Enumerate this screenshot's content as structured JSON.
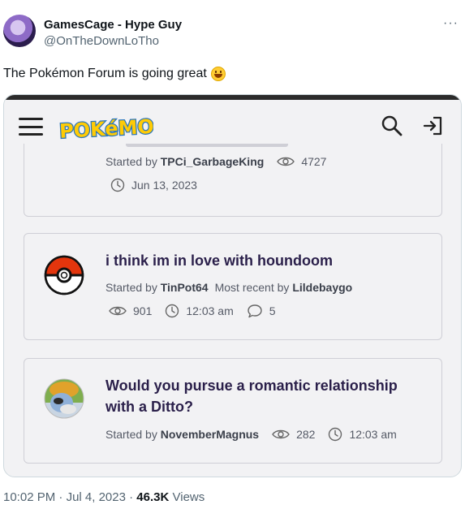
{
  "tweet": {
    "display_name": "GamesCage - Hype Guy",
    "handle": "@OnTheDownLoTho",
    "more_label": "···",
    "text": "The Pokémon Forum is going great",
    "time": "10:02 PM",
    "date": "Jul 4, 2023",
    "separator": "·",
    "views_count": "46.3K",
    "views_label": "Views"
  },
  "forum": {
    "logo_text": "POKéMON",
    "threads": [
      {
        "started_label": "Started by",
        "author": "TPCi_GarbageKing",
        "views": "4727",
        "date": "Jun 13, 2023"
      },
      {
        "title": "i think im in love with houndoom",
        "started_label": "Started by",
        "author": "TinPot64",
        "recent_label": "Most recent by",
        "recent_author": "Lildebaygo",
        "views": "901",
        "time": "12:03 am",
        "replies": "5"
      },
      {
        "title_line1": "Would you pursue a romantic relationship",
        "title_line2": "with a Ditto?",
        "started_label": "Started by",
        "author": "NovemberMagnus",
        "views": "282",
        "time": "12:03 am"
      }
    ]
  },
  "icons": {
    "menu": "hamburger-icon",
    "search": "search-icon",
    "signin": "sign-in-icon",
    "views": "eye-icon",
    "time": "clock-icon",
    "replies": "comment-icon",
    "avatar_pokeball": "pokeball-icon"
  },
  "colors": {
    "title": "#2a1f4a",
    "meta": "#555a66",
    "card_border": "#cfcfd6",
    "card_bg": "#f2f2f4",
    "pokeball_red": "#e3350d",
    "logo_yellow": "#ffcb05",
    "logo_blue": "#2a75bb"
  }
}
